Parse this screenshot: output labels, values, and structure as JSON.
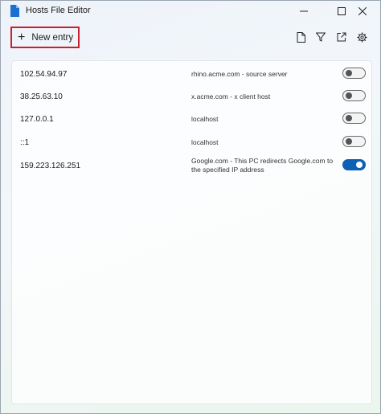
{
  "window": {
    "title": "Hosts File Editor"
  },
  "toolbar": {
    "new_entry_label": "New entry",
    "icons": [
      "new-file-icon",
      "filter-icon",
      "open-external-icon",
      "gear-icon"
    ]
  },
  "entries": [
    {
      "ip": "102.54.94.97",
      "host": "rhino.acme.com - source server",
      "enabled": false
    },
    {
      "ip": "38.25.63.10",
      "host": "x.acme.com - x client host",
      "enabled": false
    },
    {
      "ip": "127.0.0.1",
      "host": "localhost",
      "enabled": false
    },
    {
      "ip": "::1",
      "host": "localhost",
      "enabled": false
    },
    {
      "ip": "159.223.126.251",
      "host": "Google.com - This PC redirects Google.com to the specified IP address",
      "enabled": true
    }
  ],
  "colors": {
    "accent": "#0f5fb4",
    "highlight_border": "#c8202f"
  }
}
